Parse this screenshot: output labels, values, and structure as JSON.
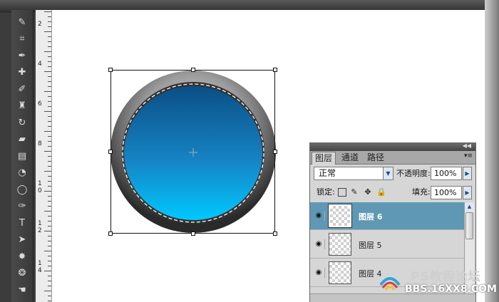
{
  "ruler": {
    "labels": [
      "2",
      "4",
      "6",
      "8",
      "10",
      "12",
      "14"
    ]
  },
  "toolbox": {
    "tools": [
      {
        "name": "quick-selection-icon",
        "glyph": "✎"
      },
      {
        "name": "crop-icon",
        "glyph": "⌗"
      },
      {
        "name": "eyedropper-icon",
        "glyph": "✒"
      },
      {
        "name": "healing-brush-icon",
        "glyph": "✚"
      },
      {
        "name": "brush-icon",
        "glyph": "✐"
      },
      {
        "name": "clone-stamp-icon",
        "glyph": "♜"
      },
      {
        "name": "history-brush-icon",
        "glyph": "↻"
      },
      {
        "name": "eraser-icon",
        "glyph": "▰"
      },
      {
        "name": "gradient-icon",
        "glyph": "▤"
      },
      {
        "name": "blur-icon",
        "glyph": "◔"
      },
      {
        "name": "dodge-icon",
        "glyph": "◯"
      },
      {
        "name": "pen-icon",
        "glyph": "✑"
      },
      {
        "name": "type-icon",
        "glyph": "T"
      },
      {
        "name": "path-selection-icon",
        "glyph": "➤"
      },
      {
        "name": "custom-shape-icon",
        "glyph": "✸"
      },
      {
        "name": "3d-rotate-icon",
        "glyph": "❂"
      },
      {
        "name": "hand-icon",
        "glyph": "☚"
      }
    ]
  },
  "layers_panel": {
    "tabs": [
      "图层",
      "通道",
      "路径"
    ],
    "active_tab": "图层",
    "blend_mode": "正常",
    "opacity_label": "不透明度:",
    "opacity_value": "100%",
    "lock_label": "锁定:",
    "fill_label": "填充:",
    "fill_value": "100%",
    "layers": [
      {
        "name": "图层 6",
        "selected": true
      },
      {
        "name": "图层 5",
        "selected": false
      },
      {
        "name": "图层 4",
        "selected": false
      }
    ]
  },
  "watermark": {
    "line1": "PS教程论坛",
    "line2": "BBS.16XX8.COM"
  },
  "colors": {
    "selected_layer": "#5f98b4",
    "button_blue": "#00c8ff",
    "ring_dark": "#2d2d2d"
  }
}
